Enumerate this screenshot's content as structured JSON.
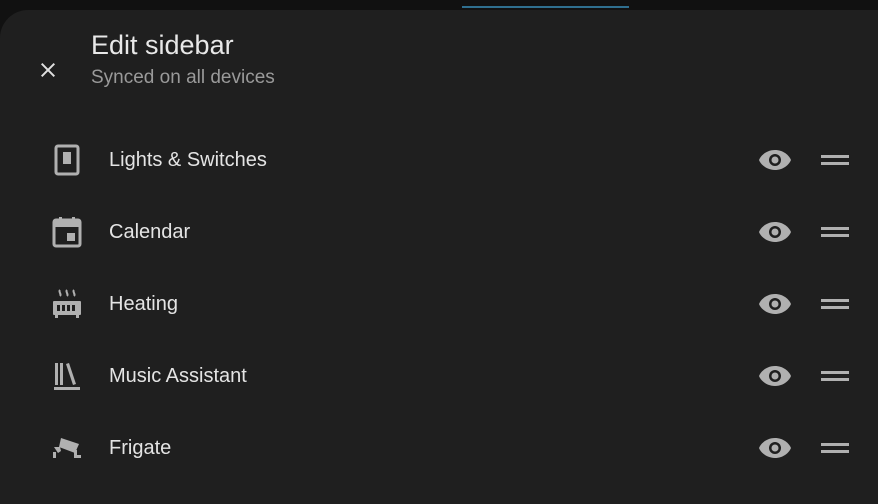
{
  "dialog": {
    "title": "Edit sidebar",
    "subtitle": "Synced on all devices",
    "close_icon": "close-icon"
  },
  "items": [
    {
      "label": "Lights & Switches",
      "icon": "light-switch-icon",
      "visible": true
    },
    {
      "label": "Calendar",
      "icon": "calendar-icon",
      "visible": true
    },
    {
      "label": "Heating",
      "icon": "radiator-icon",
      "visible": true
    },
    {
      "label": "Music Assistant",
      "icon": "bookshelf-icon",
      "visible": true
    },
    {
      "label": "Frigate",
      "icon": "cctv-icon",
      "visible": true
    }
  ],
  "colors": {
    "background": "#1f1f1f",
    "text": "#e4e4e4",
    "secondary_text": "#9a9a9a",
    "icon": "#b0b0b0",
    "accent": "#2f6f8f"
  }
}
